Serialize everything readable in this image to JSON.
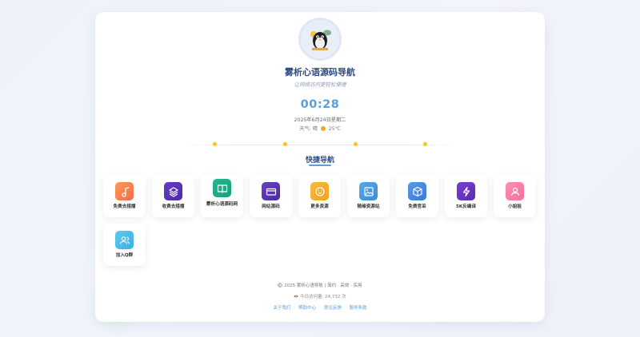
{
  "header": {
    "title": "雾析心语源码导航",
    "subtitle": "让网络访问更轻松便捷",
    "avatar_icon": "penguin-icon"
  },
  "clock": {
    "time": "00:28",
    "date": "2025年6月24日星期二",
    "weather_label": "天气:",
    "weather_condition": "晴",
    "weather_temp": "25℃",
    "weather_icon": "sun-icon"
  },
  "quick_nav": {
    "title": "快捷导航",
    "items": [
      {
        "label": "免费去措播",
        "icon": "music-note-icon",
        "color": "#f36a4a",
        "color2": "#fb9a5a"
      },
      {
        "label": "收费去措播",
        "icon": "layers-icon",
        "color": "#4b2aa8",
        "color2": "#6a3ac8"
      },
      {
        "label": "雾析心语源码网",
        "icon": "book-icon",
        "color": "#18a07a",
        "color2": "#20b890"
      },
      {
        "label": "网站源码",
        "icon": "credit-card-icon",
        "color": "#4a2aa8",
        "color2": "#6840c0"
      },
      {
        "label": "更多资源",
        "icon": "smile-icon",
        "color": "#f5a020",
        "color2": "#fbb840"
      },
      {
        "label": "随缘资源站",
        "icon": "image-icon",
        "color": "#3a8ad8",
        "color2": "#5aa8e8"
      },
      {
        "label": "免费官采",
        "icon": "package-icon",
        "color": "#3a7ad8",
        "color2": "#5a98e8"
      },
      {
        "label": "5K反编译",
        "icon": "lightning-icon",
        "color": "#5a2ab8",
        "color2": "#7840d0"
      },
      {
        "label": "小姐姐",
        "icon": "user-icon",
        "color": "#f8709a",
        "color2": "#fb90b0"
      },
      {
        "label": "加入Q群",
        "icon": "users-icon",
        "color": "#3ab0e8",
        "color2": "#60c8f0"
      }
    ]
  },
  "footer": {
    "copyright": "2025 雾析心语导航 | 简约 · 高效 · 实用",
    "visits": "今日访问量: 24,732 次",
    "links": [
      "关于我们",
      "帮助中心",
      "意见反馈",
      "服务条款"
    ]
  }
}
